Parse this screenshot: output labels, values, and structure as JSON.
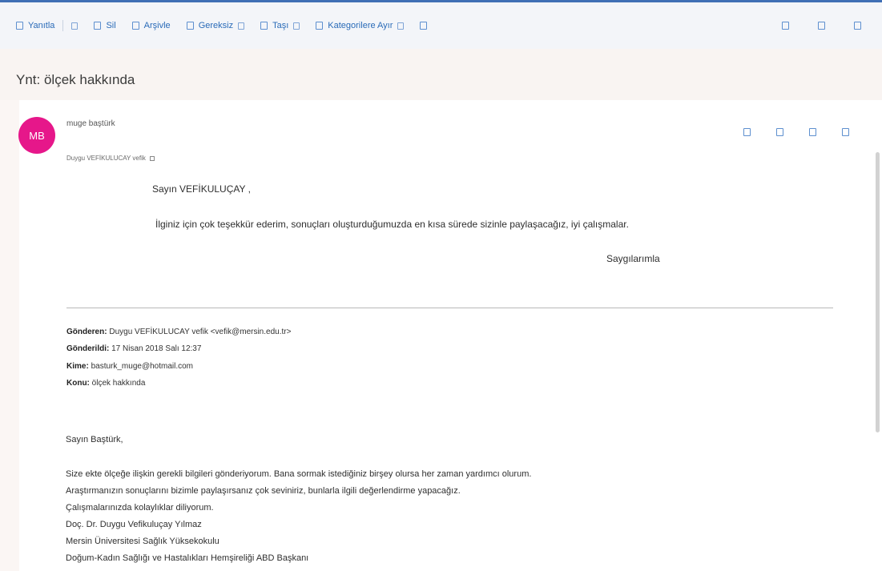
{
  "toolbar": {
    "reply_label": "Yanıtla",
    "delete_label": "Sil",
    "archive_label": "Arşivle",
    "junk_label": "Gereksiz",
    "move_label": "Taşı",
    "categorize_label": "Kategorilere Ayır"
  },
  "message": {
    "subject": "Ynt: ölçek hakkında",
    "avatar_initials": "MB",
    "avatar_color": "#e6178a",
    "sender": "muge baştürk",
    "recipient": "Duygu VEFİKULUCAY vefik"
  },
  "reply": {
    "greeting": "Sayın VEFİKULUÇAY ,",
    "body": "İlginiz için çok teşekkür ederim, sonuçları oluşturduğumuzda en kısa sürede sizinle paylaşacağız, iyi çalışmalar.",
    "closing": "Saygılarımla"
  },
  "original": {
    "from_label": "Gönderen:",
    "from_value": "Duygu VEFİKULUCAY vefik <vefik@mersin.edu.tr>",
    "sent_label": "Gönderildi:",
    "sent_value": "17 Nisan 2018 Salı 12:37",
    "to_label": "Kime:",
    "to_value": "basturk_muge@hotmail.com",
    "subject_label": "Konu:",
    "subject_value": "ölçek hakkında",
    "greeting": "Sayın Baştürk,",
    "lines": [
      "Size ekte ölçeğe ilişkin gerekli bilgileri gönderiyorum. Bana sormak istediğiniz birşey olursa her zaman yardımcı olurum.",
      "Araştırmanızın sonuçlarını bizimle paylaşırsanız çok seviniriz, bunlarla ilgili değerlendirme yapacağız.",
      "Çalışmalarınızda kolaylıklar diliyorum.",
      "Doç. Dr. Duygu Vefikuluçay Yılmaz",
      "Mersin Üniversitesi Sağlık Yüksekokulu",
      "Doğum-Kadın Sağlığı ve Hastalıkları Hemşireliği ABD Başkanı"
    ]
  }
}
